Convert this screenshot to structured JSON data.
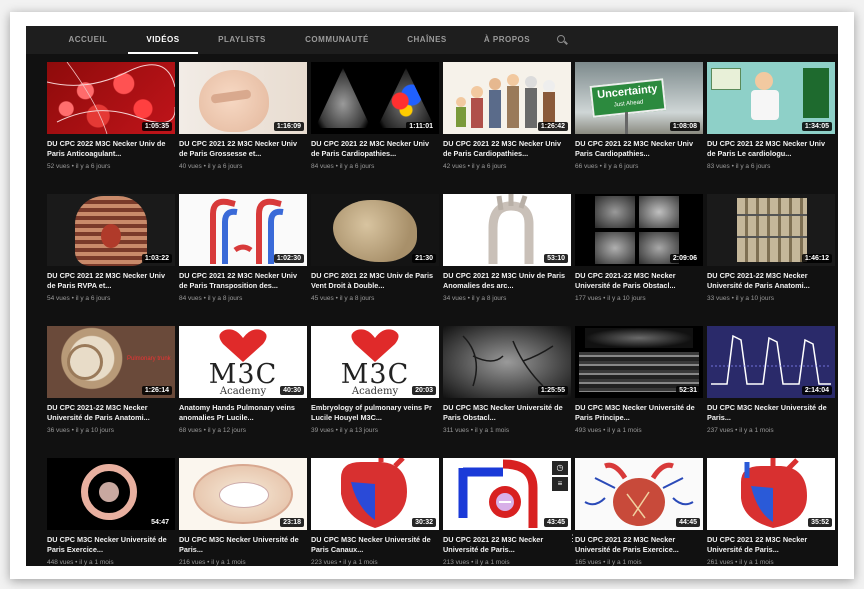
{
  "tabs": [
    {
      "label": "ACCUEIL",
      "active": false
    },
    {
      "label": "VIDÉOS",
      "active": true
    },
    {
      "label": "PLAYLISTS",
      "active": false
    },
    {
      "label": "COMMUNAUTÉ",
      "active": false
    },
    {
      "label": "CHAÎNES",
      "active": false
    },
    {
      "label": "À PROPOS",
      "active": false
    }
  ],
  "search_icon": "search-icon",
  "videos": [
    {
      "duration": "1:05:35",
      "title": "DU CPC 2022 M3C Necker Univ de Paris Anticoagulant...",
      "meta": "52 vues • il y a 6 jours"
    },
    {
      "duration": "1:16:09",
      "title": "DU CPC 2021 22 M3C Necker Univ de Paris Grossesse et...",
      "meta": "40 vues • il y a 6 jours"
    },
    {
      "duration": "1:11:01",
      "title": "DU CPC 2021 22 M3C Necker Univ de Paris Cardiopathies...",
      "meta": "84 vues • il y a 6 jours"
    },
    {
      "duration": "1:26:42",
      "title": "DU CPC 2021 22 M3C Necker Univ de Paris Cardiopathies...",
      "meta": "42 vues • il y a 6 jours"
    },
    {
      "duration": "1:08:08",
      "title": "DU CPC 2021 22 M3C Necker Univ Paris Cardiopathies...",
      "meta": "66 vues • il y a 6 jours",
      "sign_text": "Uncertainty",
      "sign_sub": "Just Ahead"
    },
    {
      "duration": "1:34:05",
      "title": "DU CPC 2021 22 M3C Necker Univ de Paris Le cardiologu...",
      "meta": "83 vues • il y a 6 jours"
    },
    {
      "duration": "1:03:22",
      "title": "DU CPC 2021 22 M3C Necker Univ de Paris RVPA et...",
      "meta": "54 vues • il y a 6 jours"
    },
    {
      "duration": "1:02:30",
      "title": "DU CPC 2021 22 M3C Necker Univ de Paris Transposition des...",
      "meta": "84 vues • il y a 8 jours"
    },
    {
      "duration": "21:30",
      "title": "DU CPC 2021 22 M3C Univ de Paris Vent Droit à Double...",
      "meta": "45 vues • il y a 8 jours"
    },
    {
      "duration": "53:10",
      "title": "DU CPC 2021 22 M3C Univ de Paris Anomalies des arc...",
      "meta": "34 vues • il y a 8 jours"
    },
    {
      "duration": "2:09:06",
      "title": "DU CPC 2021-22 M3C Necker Université de Paris Obstacl...",
      "meta": "177 vues • il y a 10 jours"
    },
    {
      "duration": "1:46:12",
      "title": "DU CPC 2021-22 M3C Necker Université de Paris Anatomi...",
      "meta": "33 vues • il y a 10 jours"
    },
    {
      "duration": "1:26:14",
      "title": "DU CPC 2021-22 M3C Necker Université de Paris Anatomi...",
      "meta": "36 vues • il y a 10 jours",
      "overlay_label": "Pulmonary trunk"
    },
    {
      "duration": "40:30",
      "title": "Anatomy Hands Pulmonary veins anomalies Pr Lucile...",
      "meta": "68 vues • il y a 12 jours",
      "logo_text": "M3C",
      "logo_sub": "Academy"
    },
    {
      "duration": "20:03",
      "title": "Embryology of pulmonary veins Pr Lucile Houyel M3C...",
      "meta": "39 vues • il y a 13 jours",
      "logo_text": "M3C",
      "logo_sub": "Academy"
    },
    {
      "duration": "1:25:55",
      "title": "DU CPC M3C Necker Université de Paris Obstacl...",
      "meta": "311 vues • il y a 1 mois"
    },
    {
      "duration": "52:31",
      "title": "DU CPC M3C Necker Université de Paris Principe...",
      "meta": "493 vues • il y a 1 mois"
    },
    {
      "duration": "2:14:04",
      "title": "DU CPC M3C Necker Université de Paris...",
      "meta": "237 vues • il y a 1 mois"
    },
    {
      "duration": "54:47",
      "title": "DU CPC M3C Necker Université de Paris Exercice...",
      "meta": "448 vues • il y a 1 mois"
    },
    {
      "duration": "23:18",
      "title": "DU CPC M3C Necker Université de Paris...",
      "meta": "216 vues • il y a 1 mois"
    },
    {
      "duration": "30:32",
      "title": "DU CPC M3C Necker Université de Paris Canaux...",
      "meta": "223 vues • il y a 1 mois"
    },
    {
      "duration": "43:45",
      "title": "DU CPC 2021 22 M3C Necker Université de Paris...",
      "meta": "213 vues • il y a 1 mois",
      "hover_icons": [
        "clock-icon",
        "queue-icon"
      ],
      "menu_icon": "more-vert-icon"
    },
    {
      "duration": "44:45",
      "title": "DU CPC 2021 22 M3C Necker Université de Paris Exercice...",
      "meta": "165 vues • il y a 1 mois"
    },
    {
      "duration": "35:52",
      "title": "DU CPC 2021 22 M3C Necker Université de Paris...",
      "meta": "261 vues • il y a 1 mois"
    }
  ],
  "colors": {
    "background": "#111111",
    "tab_bar": "#1e1e1e",
    "active_tab": "#ffffff",
    "inactive_tab": "#9a9a9a",
    "meta_text": "#9a9a9a"
  }
}
